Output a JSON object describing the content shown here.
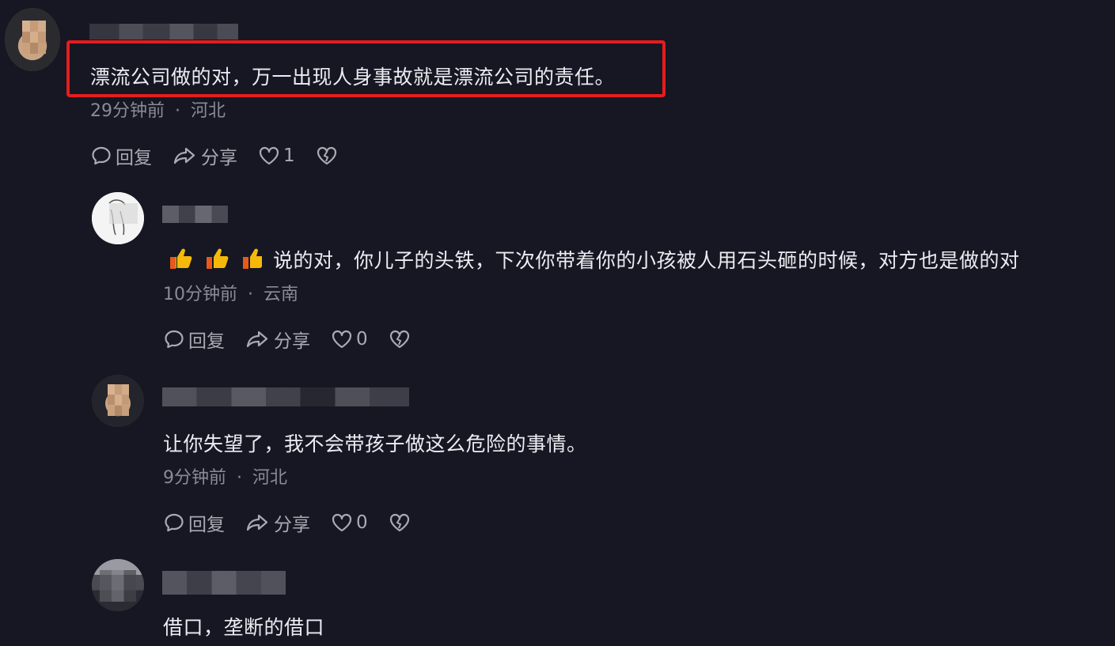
{
  "comments": [
    {
      "text": "漂流公司做的对，万一出现人身事故就是漂流公司的责任。",
      "time": "29分钟前",
      "location": "河北",
      "reply_label": "回复",
      "share_label": "分享",
      "likes": "1"
    },
    {
      "emoji": "👍👍👍",
      "text": "说的对，你儿子的头铁，下次你带着你的小孩被人用石头砸的时候，对方也是做的对",
      "time": "10分钟前",
      "location": "云南",
      "reply_label": "回复",
      "share_label": "分享",
      "likes": "0"
    },
    {
      "text": "让你失望了，我不会带孩子做这么危险的事情。",
      "time": "9分钟前",
      "location": "河北",
      "reply_label": "回复",
      "share_label": "分享",
      "likes": "0"
    },
    {
      "text": "借口，垄断的借口"
    }
  ],
  "separator": "·",
  "colors": {
    "background": "#161722",
    "highlight_border": "#e51d1d",
    "meta_text": "#8a8b95"
  },
  "icons": [
    "reply-icon",
    "share-icon",
    "like-icon",
    "dislike-icon",
    "thumbs-up-emoji"
  ]
}
